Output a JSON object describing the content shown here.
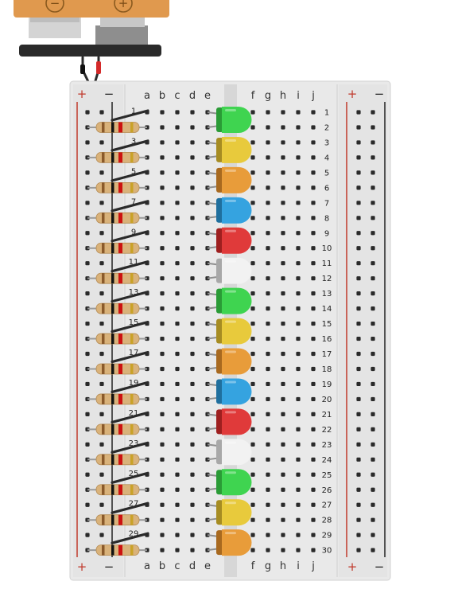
{
  "battery": {
    "minus_symbol": "−",
    "plus_symbol": "+",
    "body_color": "#e0994e"
  },
  "breadboard": {
    "columns_left": [
      "a",
      "b",
      "c",
      "d",
      "e"
    ],
    "columns_right": [
      "f",
      "g",
      "h",
      "i",
      "j"
    ],
    "row_count": 30,
    "rail_plus_symbol": "+",
    "rail_minus_symbol": "−",
    "colors": {
      "board": "#e9e9e9",
      "trench": "#d9d9d9",
      "hole": "#2a2a2a",
      "rail_red": "#c0392b",
      "rail_black": "#222222"
    }
  },
  "components": {
    "resistor_count": 15,
    "resistor_start_rows": [
      1,
      3,
      5,
      7,
      9,
      11,
      13,
      15,
      17,
      19,
      21,
      23,
      25,
      27,
      29
    ],
    "led_colors": [
      "green",
      "yellow",
      "orange",
      "blue",
      "red",
      "white",
      "green",
      "yellow",
      "orange",
      "blue",
      "red",
      "white",
      "green",
      "yellow",
      "orange"
    ],
    "led_palette": {
      "green": [
        "#3fd450",
        "#2a9b36"
      ],
      "yellow": [
        "#e8ca3c",
        "#a68c22"
      ],
      "orange": [
        "#e89c3a",
        "#a8691f"
      ],
      "blue": [
        "#35a3e0",
        "#1f6f9e"
      ],
      "red": [
        "#e03a3a",
        "#9e1f1f"
      ],
      "white": [
        "#f2f2f2",
        "#a8a8a8"
      ]
    },
    "resistor_band_colors": [
      "#8a5a2b",
      "#111111",
      "#cc1111",
      "#c9a227"
    ]
  }
}
